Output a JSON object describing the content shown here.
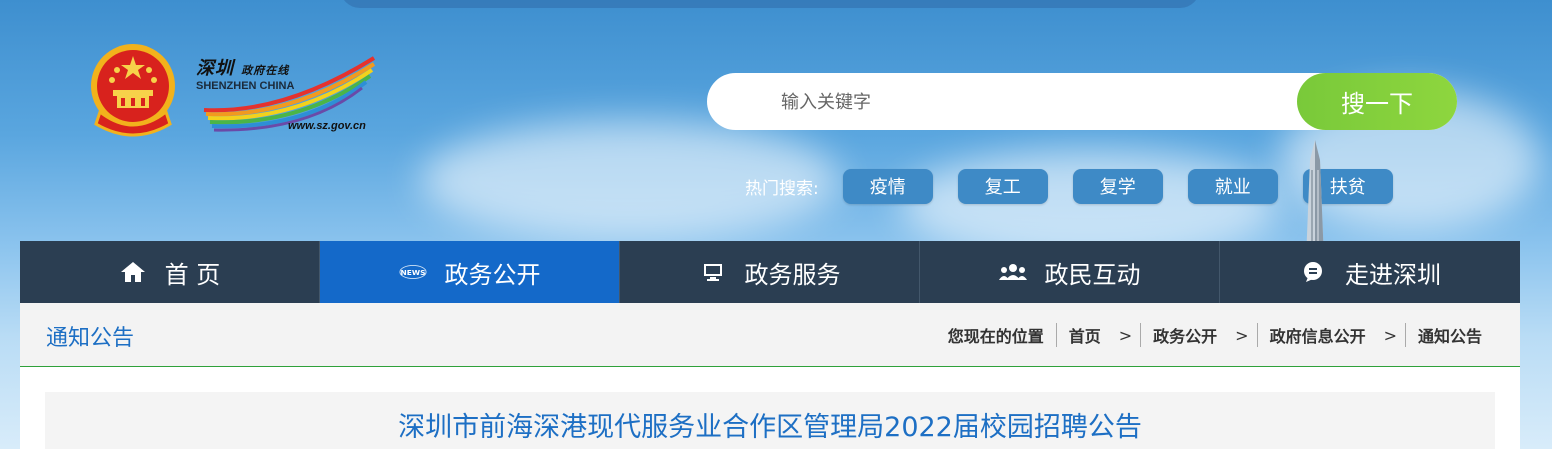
{
  "site": {
    "brand_cn": "深圳",
    "brand_cn_sub": "政府在线",
    "brand_en": "SHENZHEN CHINA",
    "brand_url": "www.sz.gov.cn"
  },
  "search": {
    "placeholder": "输入关键字",
    "button_label": "搜一下"
  },
  "hot_search": {
    "label": "热门搜索:",
    "tags": [
      "疫情",
      "复工",
      "复学",
      "就业",
      "扶贫"
    ]
  },
  "nav": {
    "items": [
      {
        "label": "首 页",
        "icon": "home-icon"
      },
      {
        "label": "政务公开",
        "icon": "news-icon",
        "active": true
      },
      {
        "label": "政务服务",
        "icon": "monitor-icon"
      },
      {
        "label": "政民互动",
        "icon": "people-icon"
      },
      {
        "label": "走进深圳",
        "icon": "chat-icon"
      }
    ]
  },
  "section": {
    "title": "通知公告"
  },
  "breadcrumb": {
    "prefix": "您现在的位置",
    "items": [
      "首页",
      "政务公开",
      "政府信息公开",
      "通知公告"
    ]
  },
  "article": {
    "title": "深圳市前海深港现代服务业合作区管理局2022届校园招聘公告"
  },
  "colors": {
    "nav_bg": "#2b3e52",
    "nav_active": "#1469c9",
    "search_button": "#84d03c",
    "link_blue": "#1d6fc4",
    "hot_tag": "#3e8ac6"
  }
}
